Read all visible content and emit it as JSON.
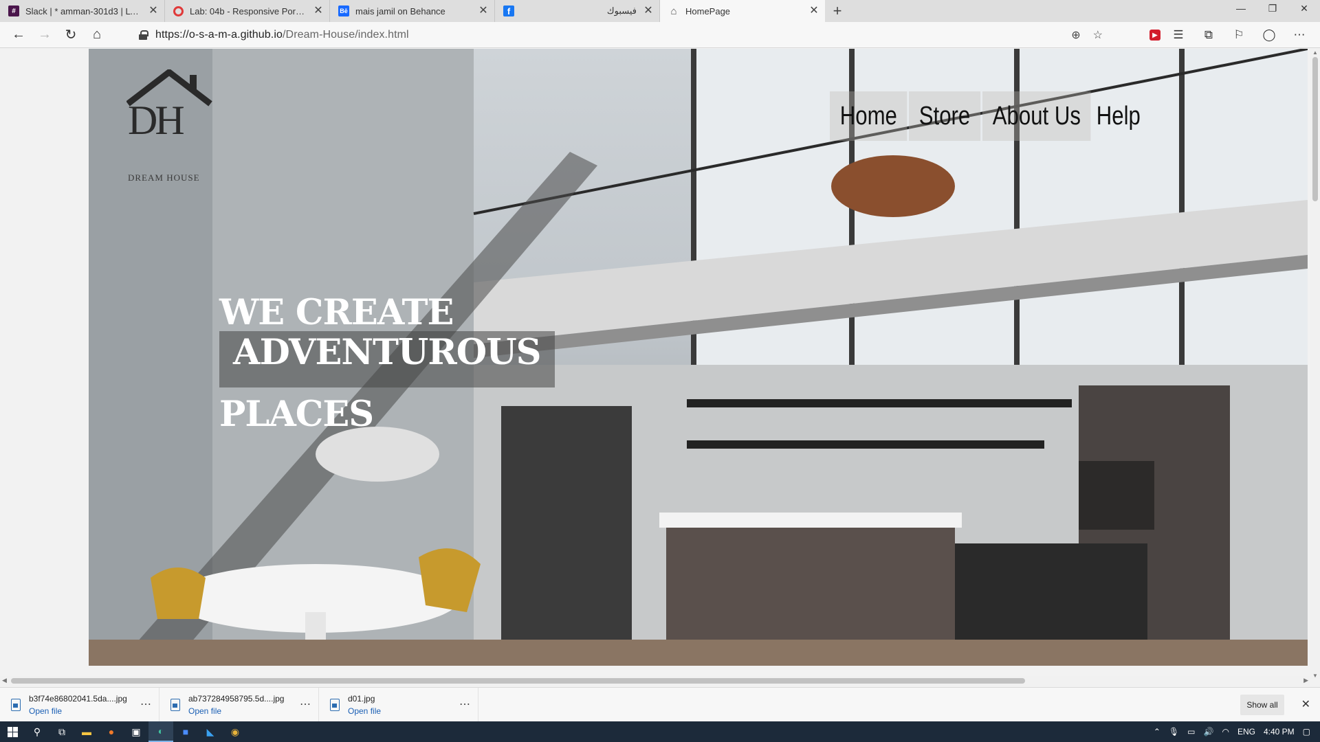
{
  "tabs": [
    {
      "title": "Slack | * amman-301d3 | LTUC - ...",
      "icon": "slack-icon",
      "active": false
    },
    {
      "title": "Lab: 04b - Responsive Portfolio",
      "icon": "ltuc-icon",
      "active": false
    },
    {
      "title": "mais jamil on Behance",
      "icon": "behance-icon",
      "active": false
    },
    {
      "title": "فيسبوك",
      "icon": "facebook-icon",
      "active": false
    },
    {
      "title": "HomePage",
      "icon": "home-icon",
      "active": true
    }
  ],
  "address": {
    "scheme": "https://",
    "domain": "o-s-a-m-a.github.io",
    "path": "/Dream-House/index.html"
  },
  "site": {
    "logo_monogram": "DH",
    "logo_text": "DREAM HOUSE",
    "nav": [
      "Home",
      "Store",
      "About Us",
      "Help"
    ],
    "headline": {
      "line1": "WE CREATE",
      "line2": "ADVENTUROUS",
      "line3": "PLACES"
    }
  },
  "downloads": [
    {
      "name": "b3f74e86802041.5da....jpg",
      "action": "Open file"
    },
    {
      "name": "ab737284958795.5d....jpg",
      "action": "Open file"
    },
    {
      "name": "d01.jpg",
      "action": "Open file"
    }
  ],
  "downloads_show_all": "Show all",
  "tray": {
    "lang": "ENG",
    "time": "4:40 PM"
  },
  "colors": {
    "tabstrip": "#dedede",
    "taskbar": "#1c2a3a",
    "link": "#1a5fb4",
    "headline": "#ffffff"
  }
}
